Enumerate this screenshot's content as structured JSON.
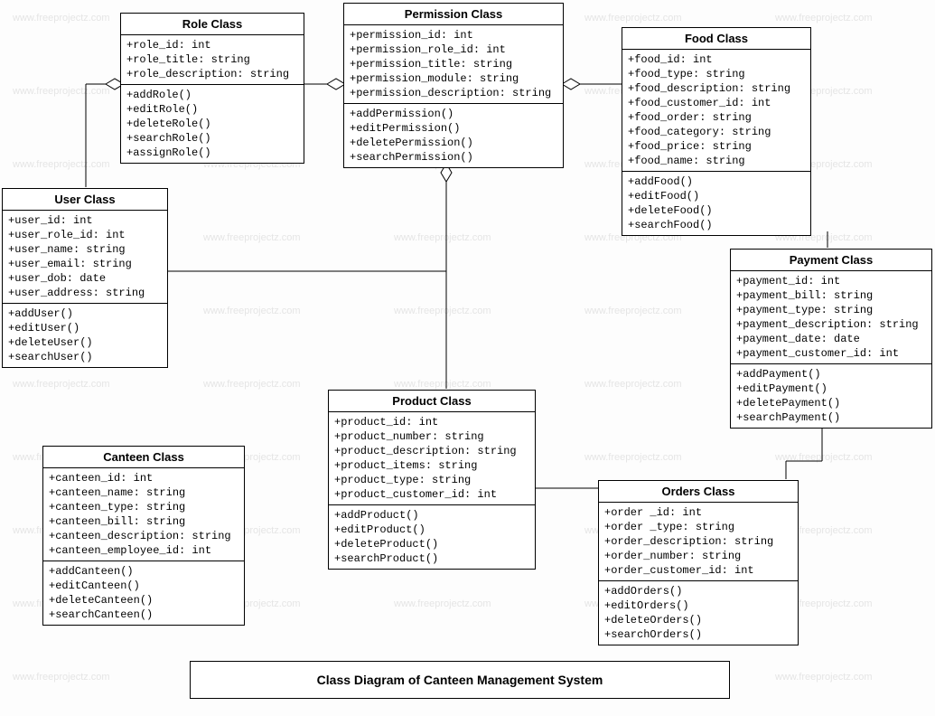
{
  "title": "Class Diagram of Canteen Management System",
  "watermark": "www.freeprojectz.com",
  "classes": {
    "role": {
      "name": "Role Class",
      "attrs": [
        "+role_id: int",
        "+role_title: string",
        "+role_description: string"
      ],
      "ops": [
        "+addRole()",
        "+editRole()",
        "+deleteRole()",
        "+searchRole()",
        "+assignRole()"
      ]
    },
    "permission": {
      "name": "Permission Class",
      "attrs": [
        "+permission_id: int",
        "+permission_role_id: int",
        "+permission_title: string",
        "+permission_module: string",
        "+permission_description: string"
      ],
      "ops": [
        "+addPermission()",
        "+editPermission()",
        "+deletePermission()",
        "+searchPermission()"
      ]
    },
    "food": {
      "name": "Food Class",
      "attrs": [
        "+food_id: int",
        "+food_type: string",
        "+food_description: string",
        "+food_customer_id: int",
        "+food_order: string",
        "+food_category: string",
        "+food_price: string",
        "+food_name: string"
      ],
      "ops": [
        "+addFood()",
        "+editFood()",
        "+deleteFood()",
        "+searchFood()"
      ]
    },
    "user": {
      "name": "User Class",
      "attrs": [
        "+user_id: int",
        "+user_role_id: int",
        "+user_name: string",
        "+user_email: string",
        "+user_dob: date",
        "+user_address: string"
      ],
      "ops": [
        "+addUser()",
        "+editUser()",
        "+deleteUser()",
        "+searchUser()"
      ]
    },
    "payment": {
      "name": "Payment Class",
      "attrs": [
        "+payment_id: int",
        "+payment_bill: string",
        "+payment_type: string",
        "+payment_description: string",
        "+payment_date: date",
        "+payment_customer_id: int"
      ],
      "ops": [
        "+addPayment()",
        "+editPayment()",
        "+deletePayment()",
        "+searchPayment()"
      ]
    },
    "product": {
      "name": "Product Class",
      "attrs": [
        "+product_id: int",
        "+product_number: string",
        "+product_description: string",
        "+product_items: string",
        "+product_type: string",
        "+product_customer_id: int"
      ],
      "ops": [
        "+addProduct()",
        "+editProduct()",
        "+deleteProduct()",
        "+searchProduct()"
      ]
    },
    "canteen": {
      "name": "Canteen Class",
      "attrs": [
        "+canteen_id: int",
        "+canteen_name: string",
        "+canteen_type: string",
        "+canteen_bill: string",
        "+canteen_description: string",
        "+canteen_employee_id: int"
      ],
      "ops": [
        "+addCanteen()",
        "+editCanteen()",
        "+deleteCanteen()",
        "+searchCanteen()"
      ]
    },
    "orders": {
      "name": "Orders Class",
      "attrs": [
        "+order _id: int",
        "+order _type: string",
        "+order_description: string",
        "+order_number: string",
        "+order_customer_id: int"
      ],
      "ops": [
        "+addOrders()",
        "+editOrders()",
        "+deleteOrders()",
        "+searchOrders()"
      ]
    }
  }
}
